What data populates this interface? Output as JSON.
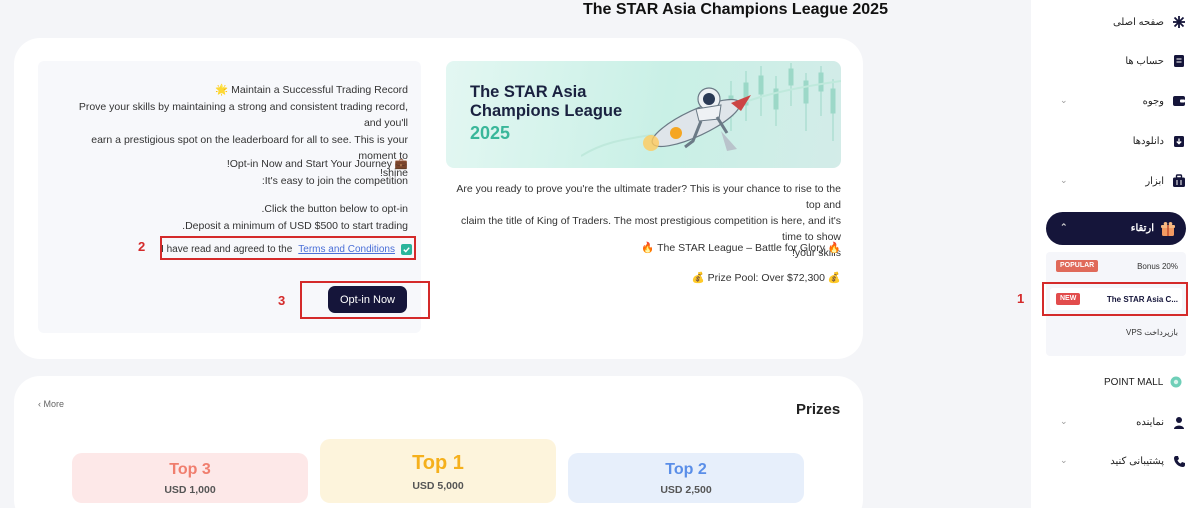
{
  "page_title": "The STAR Asia Champions League 2025",
  "left_panel": {
    "lines": [
      "Maintain a Successful Trading Record 🌟",
      "Prove your skills by maintaining a strong and consistent trading record, and you'll",
      "earn a prestigious spot on the leaderboard for all to see. This is your moment to",
      "shine!",
      "💼 Opt-in Now and Start Your Journey!",
      "It's easy to join the competition:",
      "Click the button below to opt-in.",
      "Deposit a minimum of USD $500 to start trading."
    ],
    "checkbox_label": "I have read and agreed to the",
    "terms_link": "Terms and Conditions",
    "optin_button": "Opt-in Now"
  },
  "annotations": {
    "one": "1",
    "two": "2",
    "three": "3"
  },
  "banner": {
    "line1": "The STAR Asia",
    "line2": "Champions League",
    "year": "2025"
  },
  "description": {
    "lines": [
      "Are you ready to prove you're the ultimate trader? This is your chance to rise to the top and",
      "claim the title of King of Traders. The most prestigious competition is here, and it's time to show",
      "your skills!",
      "🔥 The STAR League – Battle for Glory 🔥",
      "💰 Prize Pool: Over $72,300 💰"
    ]
  },
  "prizes": {
    "title": "Prizes",
    "more": "More",
    "items": [
      {
        "rank": "Top 3",
        "amount": "USD 1,000",
        "color": "#f07e6e",
        "bg": "#fde8e8"
      },
      {
        "rank": "Top 1",
        "amount": "USD 5,000",
        "color": "#f5b01c",
        "bg": "#fdf4dc"
      },
      {
        "rank": "Top 2",
        "amount": "USD 2,500",
        "color": "#5a8ee8",
        "bg": "#e7effb"
      }
    ]
  },
  "sidebar": {
    "home": "صفحه اصلی",
    "accounts": "حساب ها",
    "funds": "وجوه",
    "downloads": "دانلودها",
    "tools": "ابزار",
    "upgrade": "ارتقاء",
    "sub_bonus": "Bonus 20%",
    "sub_bonus_badge": "POPULAR",
    "sub_star": "The STAR Asia C...",
    "sub_star_badge": "NEW",
    "sub_vps": "بازپرداخت VPS",
    "point_mall": "POINT MALL",
    "representative": "نماینده",
    "support": "پشتیبانی کنید"
  },
  "colors": {
    "accent": "#15153a",
    "brand_green": "#39b79a",
    "annotation_red": "#d42a2a",
    "popular_badge": "#e06a5a",
    "new_badge": "#e24c4c"
  }
}
